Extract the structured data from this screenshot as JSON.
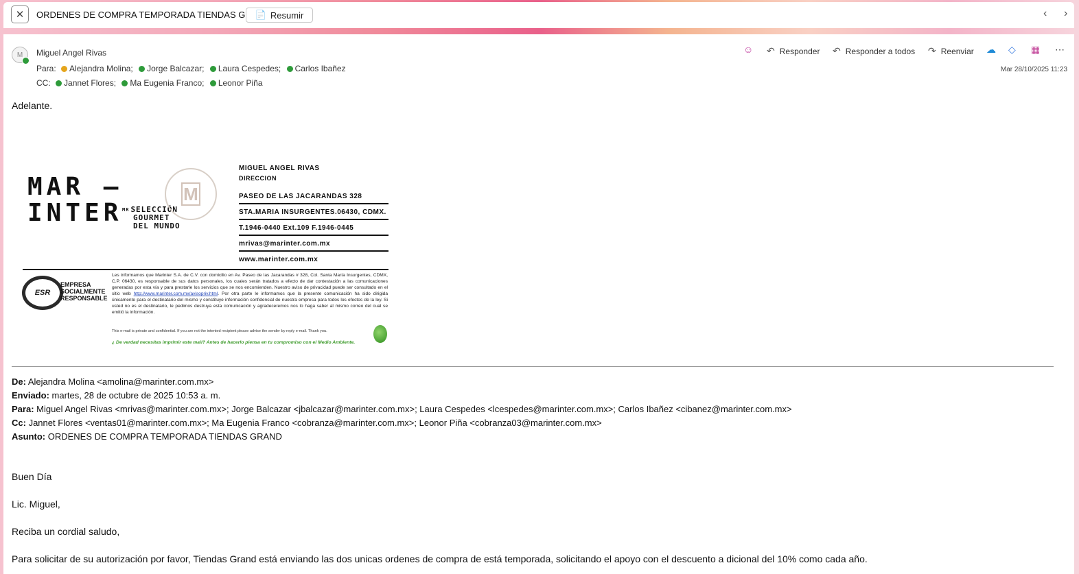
{
  "titlebar": {
    "close_icon": "close-icon",
    "subject": "ORDENES DE COMPRA TEMPORADA TIENDAS GRAND",
    "summarize_label": "Resumir",
    "prev_icon": "chevron-left-icon",
    "next_icon": "chevron-right-icon"
  },
  "message": {
    "sender": "Miguel Angel Rivas",
    "to_label": "Para:",
    "to": [
      {
        "name": "Alejandra Molina;",
        "status": "away"
      },
      {
        "name": "Jorge Balcazar;",
        "status": "available"
      },
      {
        "name": "Laura Cespedes;",
        "status": "available"
      },
      {
        "name": "Carlos Ibañez",
        "status": "available"
      }
    ],
    "cc_label": "CC:",
    "cc": [
      {
        "name": "Jannet Flores;",
        "status": "available"
      },
      {
        "name": "Ma Eugenia Franco;",
        "status": "available"
      },
      {
        "name": "Leonor Piña",
        "status": "available"
      }
    ],
    "date": "Mar 28/10/2025 11:23",
    "actions": {
      "reply": "Responder",
      "reply_all": "Responder a todos",
      "forward": "Reenviar"
    },
    "body_intro": "Adelante."
  },
  "signature": {
    "logo_line1": "MAR –",
    "logo_line2": "INTER",
    "mr": "MR",
    "tagline": [
      "SELECCIÓN",
      "GOURMET",
      "DEL MUNDO"
    ],
    "seal_letter": "M",
    "name": "MIGUEL ANGEL RIVAS",
    "title": "DIRECCION",
    "address1": "PASEO DE LAS JACARANDAS 328",
    "address2": "STA.MARIA INSURGENTES.06430, CDMX.",
    "phone": "T.1946-0440 Ext.109 F.1946-0445",
    "email": "mrivas@marinter.com.mx",
    "web": "www.marinter.com.mx",
    "esr_badge": "ESR",
    "esr_lines": [
      "EMPRESA",
      "SOCIALMENTE",
      "RESPONSABLE"
    ],
    "legal_part1": "Les informamos que Marinter S.A. de C.V. con domicilio en Av. Paseo de las Jacarandas # 328, Col. Santa María Insurgentes, CDMX, C.P. 06430, es responsable de sus datos personales, los cuales serán tratados a efecto de dar contestación a las comunicaciones generadas por esta vía y para prestarle los servicios que se nos encomienden. Nuestro aviso de privacidad puede ser consultado en el sitio web",
    "legal_link": "http://www.marinter.com.mx/avisopriv.html",
    "legal_part2": ". Por otra parte le informamos que la presente comunicación ha sido dirigida únicamente para el destinatario del mismo y constituye información confidencial de nuestra empresa para todos los efectos de la ley. Si usted no es el destinatario, le pedimos destruya esta comunicación y agradeceremos nos lo haga saber al mismo correo del cual se emitió la información.",
    "confidential": "This e-mail is private and confidential. If you are not the intented recipient please advise the sender by reply e-mail. Thank you.",
    "eco_note": "¿ De verdad necesitas imprimir este mail? Antes de hacerlo piensa en tu compromiso con el Medio Ambiente."
  },
  "forwarded": {
    "from_label": "De:",
    "from": "Alejandra Molina <amolina@marinter.com.mx>",
    "sent_label": "Enviado:",
    "sent": "martes, 28 de octubre de 2025 10:53 a. m.",
    "to_label": "Para:",
    "to": "Miguel Angel Rivas <mrivas@marinter.com.mx>; Jorge Balcazar <jbalcazar@marinter.com.mx>; Laura Cespedes <lcespedes@marinter.com.mx>; Carlos Ibañez <cibanez@marinter.com.mx>",
    "cc_label": "Cc:",
    "cc": "Jannet Flores <ventas01@marinter.com.mx>; Ma Eugenia Franco <cobranza@marinter.com.mx>; Leonor Piña <cobranza03@marinter.com.mx>",
    "subject_label": "Asunto:",
    "subject": "ORDENES DE COMPRA TEMPORADA TIENDAS GRAND",
    "greeting": "Buen Día",
    "salutation": "Lic. Miguel,",
    "regards": "Reciba un cordial saludo,",
    "paragraph": "Para solicitar de su autorización por favor,  Tiendas Grand está enviando las dos unicas ordenes de compra de está temporada,  solicitando el apoyo con el descuento a dicional del 10% como cada año."
  },
  "colors": {
    "available": "#2e9b3a",
    "away": "#e5a51c",
    "link": "#2246b8",
    "eco_green": "#3c9a2a"
  }
}
